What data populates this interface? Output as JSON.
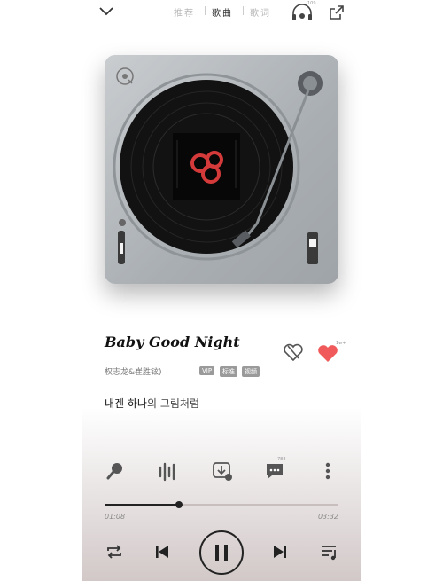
{
  "header": {
    "tabs": [
      {
        "label": "推荐",
        "active": false
      },
      {
        "label": "歌曲",
        "active": true
      },
      {
        "label": "歌词",
        "active": false
      }
    ],
    "headphone_badge": "109",
    "icons": [
      "chevron-down-icon",
      "headphone-icon",
      "share-icon"
    ]
  },
  "player": {
    "plate_color": "#b2b7bb",
    "record_label_color": "#d43a3a"
  },
  "song": {
    "title": "Baby Good Night",
    "artist": "权志龙&崔胜铉)",
    "badges": [
      "VIP",
      "标准",
      "视频"
    ],
    "like_count": "1w+"
  },
  "lyric": {
    "part1": "내겐 하나",
    "part2": "의 그림처럼"
  },
  "actions": {
    "comment_count": "788",
    "icons": [
      "sing-icon",
      "sound-effect-icon",
      "download-icon",
      "comment-icon",
      "more-icon"
    ]
  },
  "progress": {
    "current": "01:08",
    "total": "03:32",
    "fraction": 0.32
  },
  "controls": {
    "icons": [
      "repeat-icon",
      "previous-icon",
      "pause-icon",
      "next-icon",
      "playlist-icon"
    ]
  },
  "colors": {
    "like": "#f05a5a",
    "accent": "#111111"
  }
}
